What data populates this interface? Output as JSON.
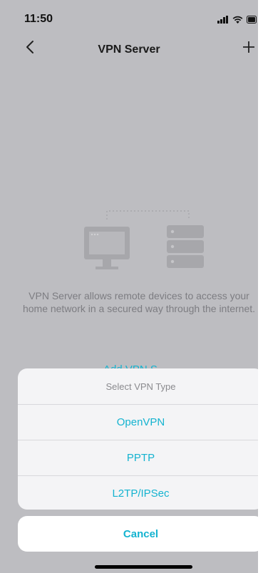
{
  "status_bar": {
    "time": "11:50",
    "icons": [
      "cellular-signal-icon",
      "wifi-icon",
      "battery-icon"
    ]
  },
  "nav": {
    "back_icon": "chevron-left-icon",
    "title": "VPN Server",
    "add_icon": "plus-icon"
  },
  "empty_state": {
    "illustration": "computer-server-icon",
    "description": "VPN Server allows remote devices to access your home network in a secured way through the internet.",
    "add_link_label": "Add VPN S..."
  },
  "action_sheet": {
    "title": "Select VPN Type",
    "options": [
      "OpenVPN",
      "PPTP",
      "L2TP/IPSec"
    ],
    "cancel_label": "Cancel"
  },
  "colors": {
    "accent": "#14b3d0",
    "overlay_bg": "#bdbdc1",
    "sheet_bg": "#f4f4f6"
  }
}
